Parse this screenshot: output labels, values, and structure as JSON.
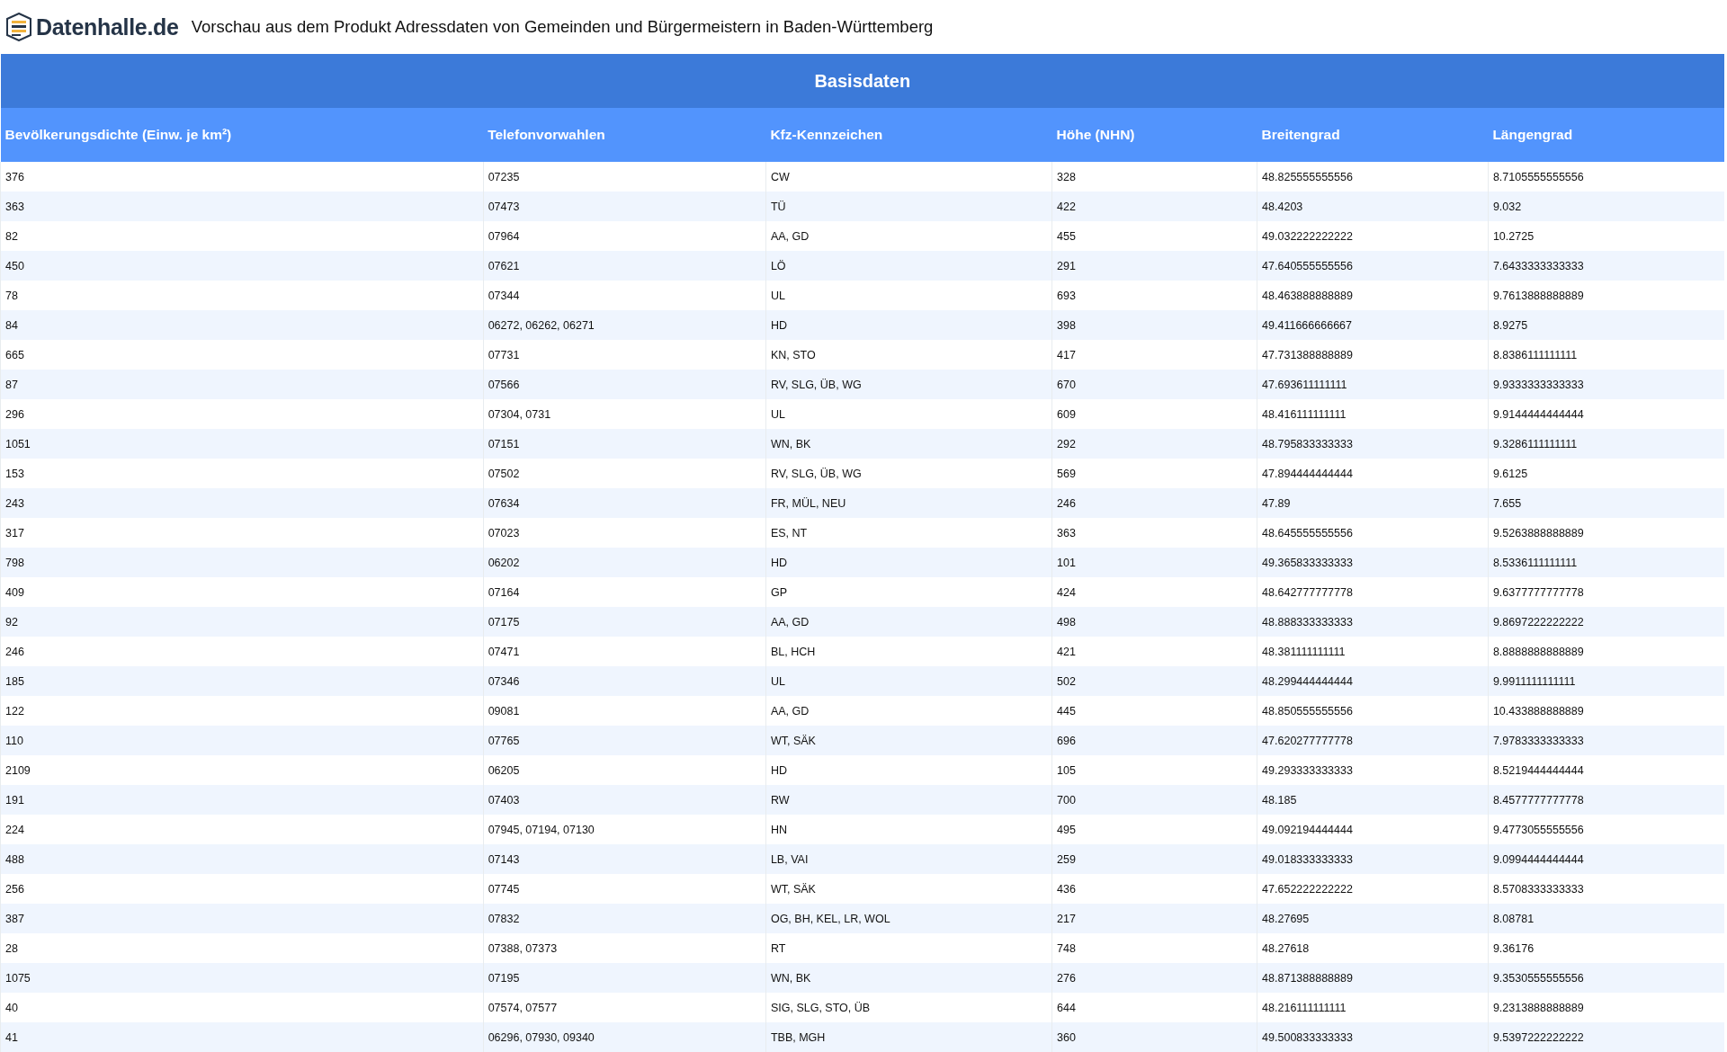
{
  "header": {
    "logo_text": "Datenhalle.de",
    "title": "Vorschau aus dem Produkt Adressdaten von Gemeinden und Bürgermeistern in Baden-Württemberg"
  },
  "table": {
    "group_title": "Basisdaten",
    "columns": [
      "Bevölkerungsdichte (Einw. je km²)",
      "Telefonvorwahlen",
      "Kfz-Kennzeichen",
      "Höhe (NHN)",
      "Breitengrad",
      "Längengrad"
    ],
    "rows": [
      [
        "376",
        "07235",
        "CW",
        "328",
        "48.825555555556",
        "8.7105555555556"
      ],
      [
        "363",
        "07473",
        "TÜ",
        "422",
        "48.4203",
        "9.032"
      ],
      [
        "82",
        "07964",
        "AA, GD",
        "455",
        "49.032222222222",
        "10.2725"
      ],
      [
        "450",
        "07621",
        "LÖ",
        "291",
        "47.640555555556",
        "7.6433333333333"
      ],
      [
        "78",
        "07344",
        "UL",
        "693",
        "48.463888888889",
        "9.7613888888889"
      ],
      [
        "84",
        "06272, 06262, 06271",
        "HD",
        "398",
        "49.411666666667",
        "8.9275"
      ],
      [
        "665",
        "07731",
        "KN, STO",
        "417",
        "47.731388888889",
        "8.8386111111111"
      ],
      [
        "87",
        "07566",
        "RV, SLG, ÜB, WG",
        "670",
        "47.693611111111",
        "9.9333333333333"
      ],
      [
        "296",
        "07304, 0731",
        "UL",
        "609",
        "48.416111111111",
        "9.9144444444444"
      ],
      [
        "1051",
        "07151",
        "WN, BK",
        "292",
        "48.795833333333",
        "9.3286111111111"
      ],
      [
        "153",
        "07502",
        "RV, SLG, ÜB, WG",
        "569",
        "47.894444444444",
        "9.6125"
      ],
      [
        "243",
        "07634",
        "FR, MÜL, NEU",
        "246",
        "47.89",
        "7.655"
      ],
      [
        "317",
        "07023",
        "ES, NT",
        "363",
        "48.645555555556",
        "9.5263888888889"
      ],
      [
        "798",
        "06202",
        "HD",
        "101",
        "49.365833333333",
        "8.5336111111111"
      ],
      [
        "409",
        "07164",
        "GP",
        "424",
        "48.642777777778",
        "9.6377777777778"
      ],
      [
        "92",
        "07175",
        "AA, GD",
        "498",
        "48.888333333333",
        "9.8697222222222"
      ],
      [
        "246",
        "07471",
        "BL, HCH",
        "421",
        "48.381111111111",
        "8.8888888888889"
      ],
      [
        "185",
        "07346",
        "UL",
        "502",
        "48.299444444444",
        "9.9911111111111"
      ],
      [
        "122",
        "09081",
        "AA, GD",
        "445",
        "48.850555555556",
        "10.433888888889"
      ],
      [
        "110",
        "07765",
        "WT, SÄK",
        "696",
        "47.620277777778",
        "7.9783333333333"
      ],
      [
        "2109",
        "06205",
        "HD",
        "105",
        "49.293333333333",
        "8.5219444444444"
      ],
      [
        "191",
        "07403",
        "RW",
        "700",
        "48.185",
        "8.4577777777778"
      ],
      [
        "224",
        "07945, 07194, 07130",
        "HN",
        "495",
        "49.092194444444",
        "9.4773055555556"
      ],
      [
        "488",
        "07143",
        "LB, VAI",
        "259",
        "49.018333333333",
        "9.0994444444444"
      ],
      [
        "256",
        "07745",
        "WT, SÄK",
        "436",
        "47.652222222222",
        "8.5708333333333"
      ],
      [
        "387",
        "07832",
        "OG, BH, KEL, LR, WOL",
        "217",
        "48.27695",
        "8.08781"
      ],
      [
        "28",
        "07388, 07373",
        "RT",
        "748",
        "48.27618",
        "9.36176"
      ],
      [
        "1075",
        "07195",
        "WN, BK",
        "276",
        "48.871388888889",
        "9.3530555555556"
      ],
      [
        "40",
        "07574, 07577",
        "SIG, SLG, STO, ÜB",
        "644",
        "48.216111111111",
        "9.2313888888889"
      ],
      [
        "41",
        "06296, 07930, 09340",
        "TBB, MGH",
        "360",
        "49.500833333333",
        "9.5397222222222"
      ]
    ]
  }
}
